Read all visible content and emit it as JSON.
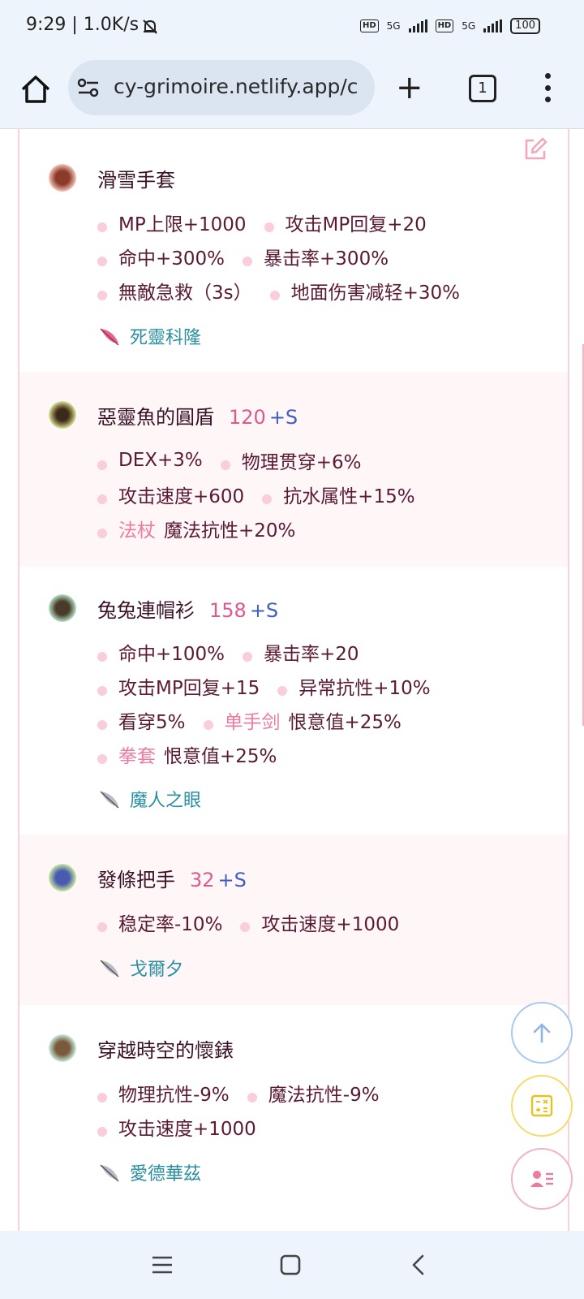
{
  "status_bar": {
    "time": "9:29 | 1.0K/s",
    "net_1": "5G",
    "net_2": "5G",
    "battery": "100"
  },
  "browser": {
    "url": "cy-grimoire.netlify.app/c",
    "tab_count": "1"
  },
  "items": [
    {
      "name": "滑雪手套",
      "level": "",
      "suffix": "",
      "stats": [
        [
          {
            "w": "",
            "t": "MP上限+1000"
          },
          {
            "w": "",
            "t": "攻击MP回复+20"
          }
        ],
        [
          {
            "w": "",
            "t": "命中+300%"
          },
          {
            "w": "",
            "t": "暴击率+300%"
          }
        ],
        [
          {
            "w": "",
            "t": "無敵急救（3s）"
          },
          {
            "w": "",
            "t": "地面伤害减轻+30%"
          }
        ]
      ],
      "source": "死靈科隆",
      "source_icon": "pink-feather-icon",
      "icon_color": "#8a3b2a"
    },
    {
      "name": "惡靈魚的圓盾",
      "level": "120",
      "suffix": "+S",
      "stats": [
        [
          {
            "w": "",
            "t": "DEX+3%"
          },
          {
            "w": "",
            "t": "物理贯穿+6%"
          }
        ],
        [
          {
            "w": "",
            "t": "攻击速度+600"
          },
          {
            "w": "",
            "t": "抗水属性+15%"
          }
        ],
        [
          {
            "w": "法杖",
            "t": "魔法抗性+20%"
          }
        ]
      ],
      "source": "",
      "source_icon": "",
      "icon_color": "#5a4a2a"
    },
    {
      "name": "兔兔連帽衫",
      "level": "158",
      "suffix": "+S",
      "stats": [
        [
          {
            "w": "",
            "t": "命中+100%"
          },
          {
            "w": "",
            "t": "暴击率+20"
          }
        ],
        [
          {
            "w": "",
            "t": "攻击MP回复+15"
          },
          {
            "w": "",
            "t": "异常抗性+10%"
          }
        ],
        [
          {
            "w": "",
            "t": "看穿5%"
          },
          {
            "w": "单手剑",
            "t": "恨意值+25%"
          }
        ],
        [
          {
            "w": "拳套",
            "t": "恨意值+25%"
          }
        ]
      ],
      "source": "魔人之眼",
      "source_icon": "grey-feather-icon",
      "icon_color": "#4a3a2a"
    },
    {
      "name": "發條把手",
      "level": "32",
      "suffix": "+S",
      "stats": [
        [
          {
            "w": "",
            "t": "稳定率-10%"
          },
          {
            "w": "",
            "t": "攻击速度+1000"
          }
        ]
      ],
      "source": "戈爾夕",
      "source_icon": "grey-feather-icon",
      "icon_color": "#4a5ab0"
    },
    {
      "name": "穿越時空的懷錶",
      "level": "",
      "suffix": "",
      "stats": [
        [
          {
            "w": "",
            "t": "物理抗性-9%"
          },
          {
            "w": "",
            "t": "魔法抗性-9%"
          }
        ],
        [
          {
            "w": "",
            "t": "攻击速度+1000"
          }
        ]
      ],
      "source": "愛德華茲",
      "source_icon": "grey-feather-icon",
      "icon_color": "#7a5a3a"
    }
  ],
  "colors": {
    "accent_pink": "#dd5a8a",
    "accent_blue": "#3f5fbf",
    "source_teal": "#2a8fa0",
    "alt_row": "#fff6f8"
  }
}
